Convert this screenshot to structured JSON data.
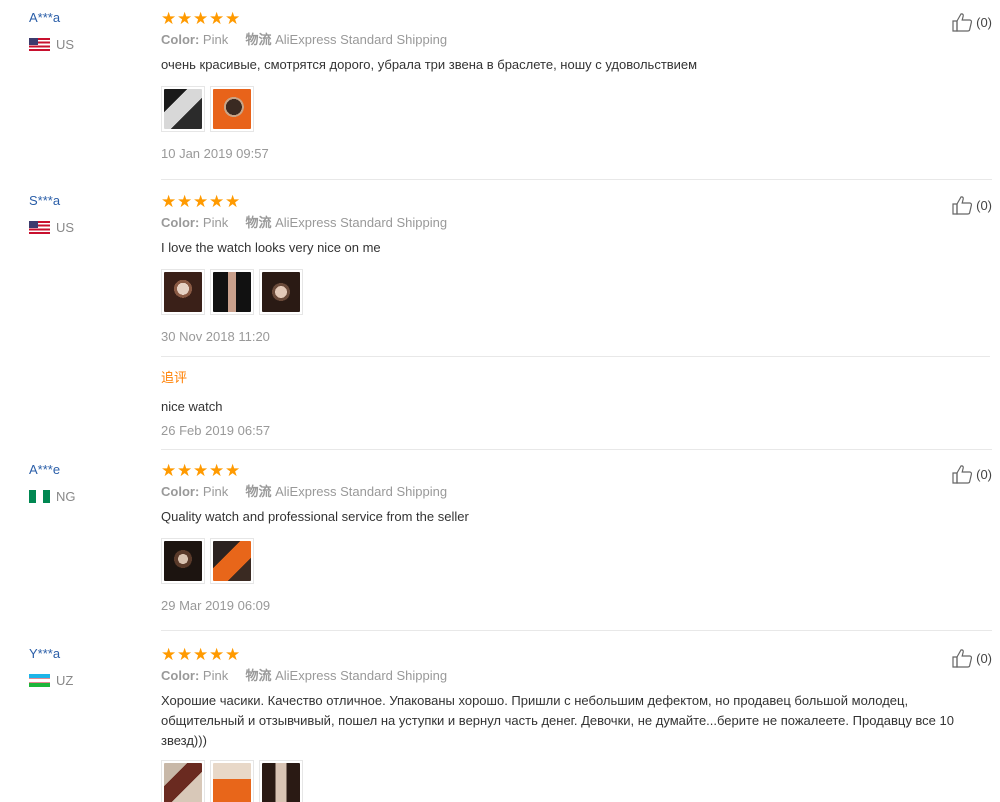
{
  "reviews": [
    {
      "user": "A***a",
      "country": "US",
      "color_label": "Color:",
      "color_value": "Pink",
      "shipping_label": "物流",
      "shipping_value": "AliExpress Standard Shipping",
      "text": "очень красивые, смотрятся дорого, убрала три звена в браслете, ношу с удовольствием",
      "date": "10 Jan 2019 09:57",
      "likes": "(0)",
      "stars": 5
    },
    {
      "user": "S***a",
      "country": "US",
      "color_label": "Color:",
      "color_value": "Pink",
      "shipping_label": "物流",
      "shipping_value": "AliExpress Standard Shipping",
      "text": "I love the watch looks very nice on me",
      "date": "30 Nov 2018 11:20",
      "likes": "(0)",
      "stars": 5,
      "followup": {
        "title": "追评",
        "text": "nice watch",
        "date": "26 Feb 2019 06:57"
      }
    },
    {
      "user": "A***e",
      "country": "NG",
      "color_label": "Color:",
      "color_value": "Pink",
      "shipping_label": "物流",
      "shipping_value": "AliExpress Standard Shipping",
      "text": "Quality watch and professional service from the seller",
      "date": "29 Mar 2019 06:09",
      "likes": "(0)",
      "stars": 5
    },
    {
      "user": "Y***a",
      "country": "UZ",
      "color_label": "Color:",
      "color_value": "Pink",
      "shipping_label": "物流",
      "shipping_value": "AliExpress Standard Shipping",
      "text": "Хорошие часики. Качество отличное. Упакованы хорошо. Пришли с небольшим дефектом, но продавец большой молодец, общительный и отзывчивый, пошел на уступки и вернул часть денег. Девочки, не думайте...берите не пожалеете. Продавцу все 10 звезд)))",
      "likes": "(0)",
      "stars": 5
    }
  ],
  "colors": {
    "username": "#2a5ea8",
    "star": "#ff9a00",
    "followup_title": "#ff7f00",
    "muted": "#999999"
  },
  "icons": {
    "star": "star-icon",
    "like": "thumbs-up-icon"
  }
}
